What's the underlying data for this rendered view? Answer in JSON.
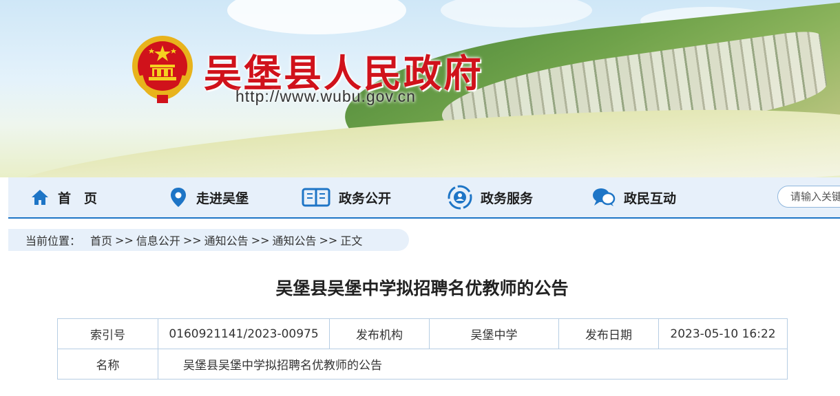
{
  "header": {
    "site_title": "吴堡县人民政府",
    "site_url": "http://www.wubu.gov.cn"
  },
  "nav": {
    "items": [
      {
        "label": "首　页",
        "icon": "home-icon"
      },
      {
        "label": "走进吴堡",
        "icon": "location-pin-icon"
      },
      {
        "label": "政务公开",
        "icon": "open-book-icon"
      },
      {
        "label": "政务服务",
        "icon": "service-globe-icon"
      },
      {
        "label": "政民互动",
        "icon": "chat-bubbles-icon"
      }
    ],
    "search_placeholder": "请输入关键",
    "accent_color": "#1e75c6"
  },
  "breadcrumb": {
    "lead": "当前位置：",
    "items": [
      "首页",
      "信息公开",
      "通知公告",
      "通知公告",
      "正文"
    ],
    "separator": ">>"
  },
  "article": {
    "title": "吴堡县吴堡中学拟招聘名优教师的公告",
    "meta": {
      "index_label": "索引号",
      "index_value": "0160921141/2023-00975",
      "org_label": "发布机构",
      "org_value": "吴堡中学",
      "date_label": "发布日期",
      "date_value": "2023-05-10 16:22",
      "name_label": "名称",
      "name_value": "吴堡县吴堡中学拟招聘名优教师的公告"
    }
  }
}
